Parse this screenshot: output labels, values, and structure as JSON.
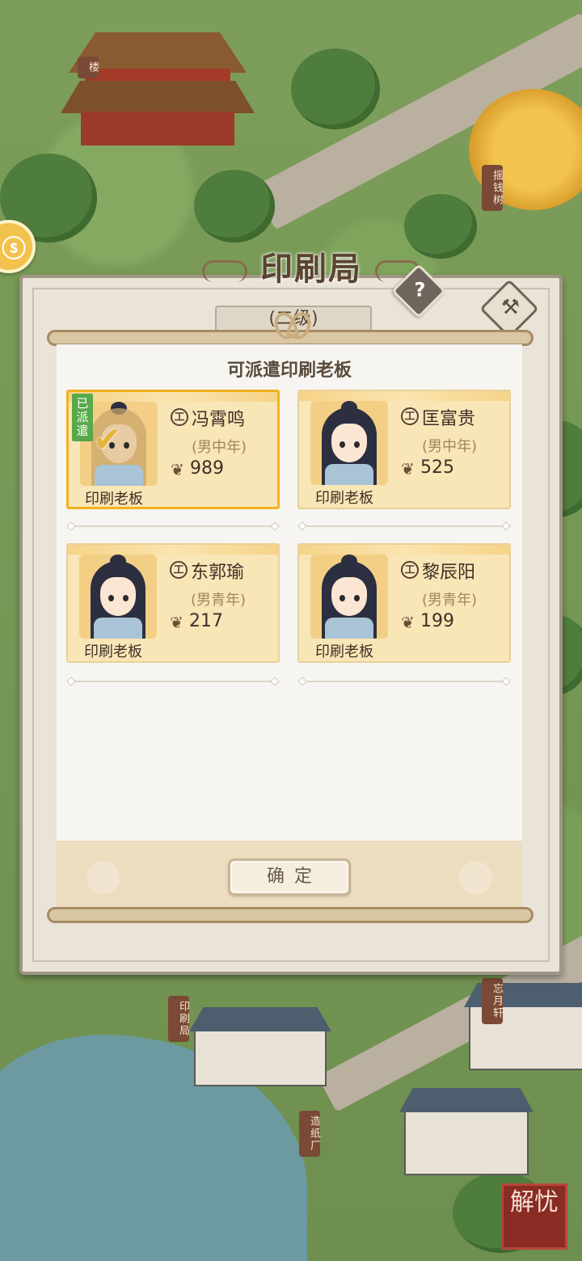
{
  "map": {
    "signs": {
      "tower": "楼",
      "money_tree": "摇钱树",
      "printing": "印刷局",
      "paper_mill": "造纸厂",
      "moon_pavilion": "忘月轩"
    },
    "seal_text": "解忧"
  },
  "building": {
    "title": "印刷局",
    "level": "(二级)",
    "help_icon": "question-mark-icon",
    "build_icon": "hammer-icon"
  },
  "modal": {
    "title": "可派遣印刷老板",
    "confirm": "确定",
    "cards": [
      {
        "dispatched_label": "已派遣",
        "name": "冯霄鸣",
        "desc": "(男中年)",
        "value": "989",
        "role": "印刷老板",
        "job": "工",
        "selected": true
      },
      {
        "name": "匡富贵",
        "desc": "(男中年)",
        "value": "525",
        "role": "印刷老板",
        "job": "工",
        "selected": false
      },
      {
        "name": "东郭瑜",
        "desc": "(男青年)",
        "value": "217",
        "role": "印刷老板",
        "job": "工",
        "selected": false
      },
      {
        "name": "黎辰阳",
        "desc": "(男青年)",
        "value": "199",
        "role": "印刷老板",
        "job": "工",
        "selected": false
      }
    ]
  },
  "colors": {
    "accent_gold": "#f2b11f",
    "dispatched_green": "#57a94a",
    "card_bg": "#f8e6b6"
  }
}
